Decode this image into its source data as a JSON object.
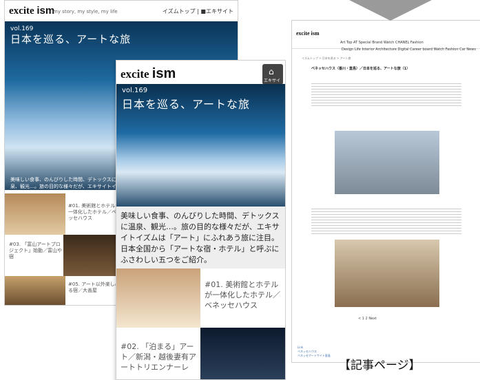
{
  "back_phone": {
    "logo": "excite",
    "logo_suffix": "ism",
    "tagline": "my story, my style, my life",
    "links": "イズムトップ | ■エキサイト",
    "vol": "vol.169",
    "title": "日本を巡る、アートな旅",
    "intro": "美味しい食事、のんびりした時間、デトックスに温泉、観光…。旅の目的な様々だが、エキサイトイズムは「アート」にふれあう旅に注目。日本全国から「アートな宿・ホテル」と呼ぶ",
    "items": [
      "#01. 美術館とホテルが一体化したホテル／ベネッセハウス",
      "#03. 「富山アートプロジェクト」始動／富山や宿",
      "#05. アート以外楽しめる宿／大善屋"
    ]
  },
  "front_phone": {
    "logo": "excite",
    "logo_suffix": "ism",
    "home_label": "エキサイト",
    "vol": "vol.169",
    "title": "日本を巡る、アートな旅",
    "intro": "美味しい食事、のんびりした時間、デトックスに温泉、観光…。旅の目的な様々だが、エキサイトイズムは「アート」にふれあう旅に注目。日本全国から「アートな宿・ホテル」と呼ぶにふさわしい五つをご紹介。",
    "items": [
      "#01. 美術館とホテルが一体化したホテル／ベネッセハウス",
      "#02. 「泊まる」アート／新潟・越後妻有アートトリエンナーレ"
    ]
  },
  "desktop_page": {
    "logo": "excite ism",
    "nav_primary": "Art Top   AT   Special   Brand Watch   CHANEL Fashion",
    "nav_secondary": "Design   Life   Interior   Architecture   Digital   Career board   Watch   Fashion   Car   News",
    "breadcrumb": "イズムトップ > 日本を巡る > アート旅",
    "title": "ベネッセハウス（香川・直島）／日本を巡る、アートな旅（1）",
    "pager": "<   1   2   Next",
    "links": "Link\nベネッセハウス\nベネッセアートサイト直島"
  },
  "caption": "【記事ページ】"
}
